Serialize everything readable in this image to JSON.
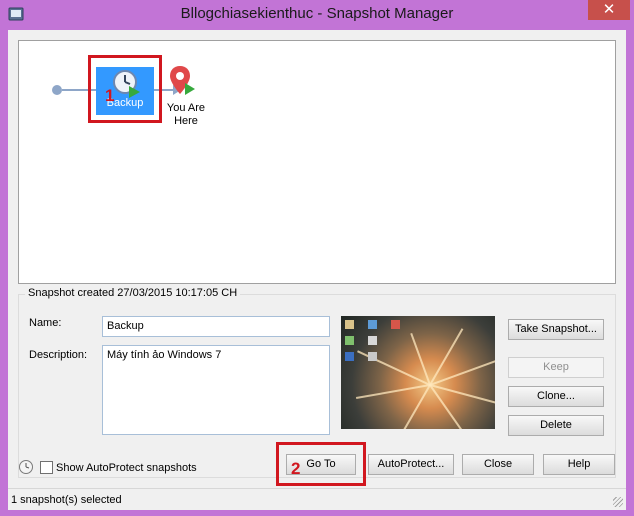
{
  "window": {
    "title": "Bllogchiasekienthuc - Snapshot Manager",
    "close_symbol": "✕"
  },
  "tree": {
    "snapshot_label": "Backup",
    "you_are_here": [
      "You Are",
      "Here"
    ],
    "annotation_1": "1"
  },
  "details": {
    "group_title": "Snapshot created 27/03/2015 10:17:05 CH",
    "name_label": "Name:",
    "name_value": "Backup",
    "description_label": "Description:",
    "description_value": "Máy tính ảo Windows 7"
  },
  "buttons": {
    "take_snapshot": "Take Snapshot...",
    "keep": "Keep",
    "clone": "Clone...",
    "delete": "Delete",
    "goto": "Go To",
    "autoprotect": "AutoProtect...",
    "close": "Close",
    "help": "Help"
  },
  "annotation_2": "2",
  "autoprotect_checkbox": {
    "label": "Show AutoProtect snapshots",
    "checked": false
  },
  "status": {
    "text": "1 snapshot(s) selected"
  },
  "colors": {
    "title_bar": "#c274d6",
    "selection": "#3399ff",
    "annotation": "#d1171f",
    "close_button": "#c7504b"
  },
  "icons": [
    "vmware-app-icon",
    "clock-snapshot-icon",
    "you-are-here-pin-icon",
    "autoprotect-clock-icon"
  ]
}
